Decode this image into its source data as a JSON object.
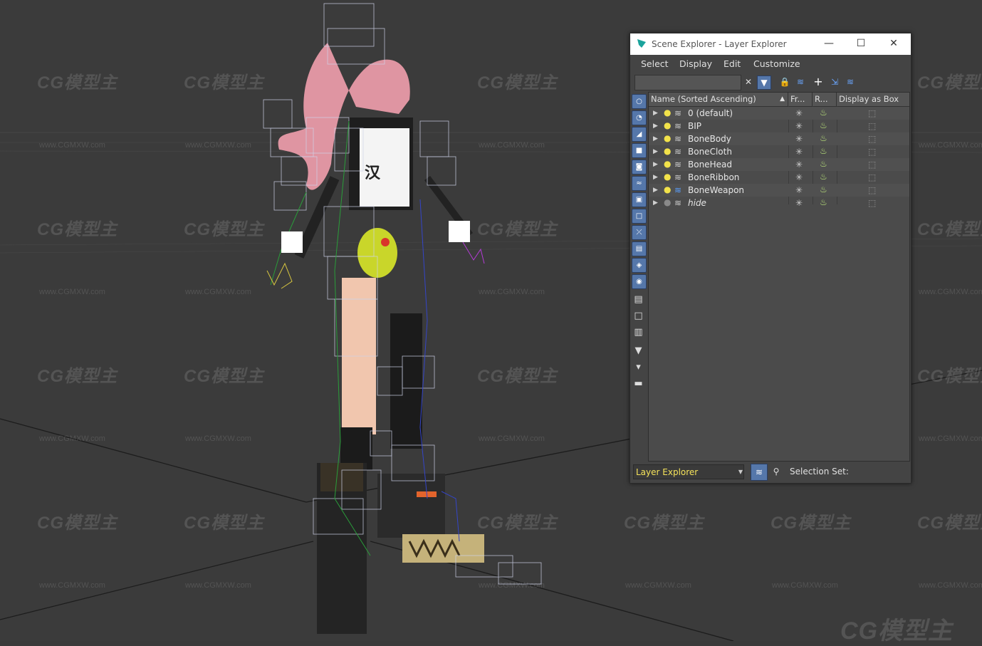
{
  "watermark": {
    "brand": "CG模型主",
    "url": "www.CGMXW.com"
  },
  "window": {
    "title": "Scene Explorer - Layer Explorer",
    "controls": {
      "minimize": "—",
      "maximize": "☐",
      "close": "✕"
    }
  },
  "menu": [
    "Select",
    "Display",
    "Edit",
    "Customize"
  ],
  "toolbar": {
    "search_value": "",
    "clear": "✕"
  },
  "columns": {
    "name": "Name (Sorted Ascending)",
    "freeze": "Fr...",
    "render": "R...",
    "display_box": "Display as Box"
  },
  "layers": [
    {
      "name": "0 (default)",
      "on": true,
      "italic": false,
      "highlight": false
    },
    {
      "name": "BIP",
      "on": true,
      "italic": false,
      "highlight": false
    },
    {
      "name": "BoneBody",
      "on": true,
      "italic": false,
      "highlight": false
    },
    {
      "name": "BoneCloth",
      "on": true,
      "italic": false,
      "highlight": false
    },
    {
      "name": "BoneHead",
      "on": true,
      "italic": false,
      "highlight": false
    },
    {
      "name": "BoneRibbon",
      "on": true,
      "italic": false,
      "highlight": false
    },
    {
      "name": "BoneWeapon",
      "on": true,
      "italic": false,
      "highlight": true
    },
    {
      "name": "hide",
      "on": false,
      "italic": true,
      "highlight": false
    }
  ],
  "bottom": {
    "mode": "Layer Explorer",
    "selection_set": "Selection Set:"
  },
  "colors": {
    "accent": "#5577aa",
    "mode_text": "#f5e35a",
    "viewport_bg": "#3b3b3b"
  }
}
